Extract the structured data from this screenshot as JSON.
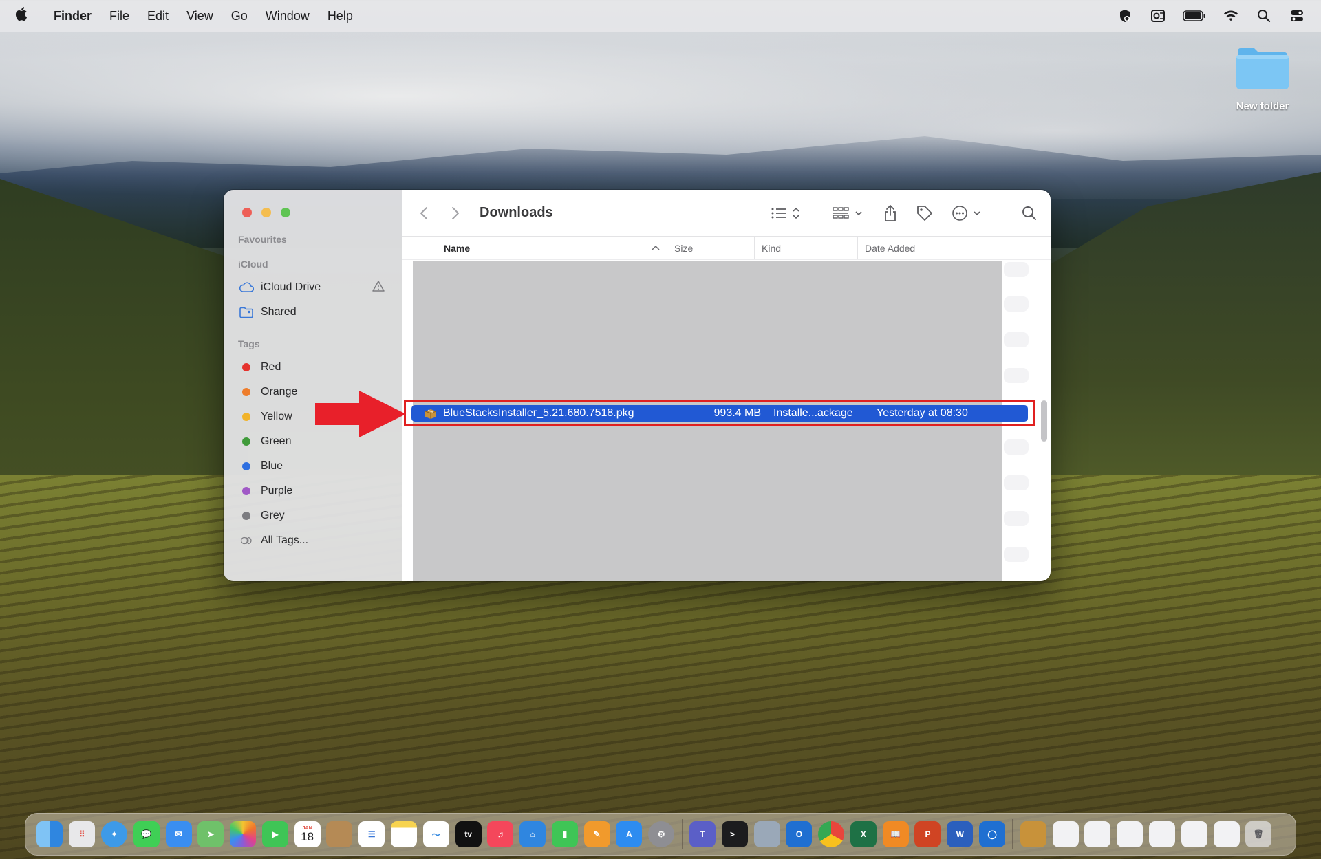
{
  "menubar": {
    "apple_icon": "apple-icon",
    "app_name": "Finder",
    "items": [
      "File",
      "Edit",
      "View",
      "Go",
      "Window",
      "Help"
    ],
    "status_icons": [
      "security-icon",
      "outlook-icon",
      "battery-icon",
      "wifi-icon",
      "spotlight-icon",
      "control-center-icon"
    ]
  },
  "desktop": {
    "folder_label": "New folder"
  },
  "finder": {
    "title": "Downloads",
    "sidebar": {
      "favourites_title": "Favourites",
      "icloud_title": "iCloud",
      "icloud_items": [
        {
          "label": "iCloud Drive",
          "icon": "cloud-icon"
        },
        {
          "label": "Shared",
          "icon": "shared-folder-icon"
        }
      ],
      "tags_title": "Tags",
      "tags": [
        {
          "label": "Red",
          "color": "#e5322d"
        },
        {
          "label": "Orange",
          "color": "#ee7d2b"
        },
        {
          "label": "Yellow",
          "color": "#f1b32a"
        },
        {
          "label": "Green",
          "color": "#3f9a3a"
        },
        {
          "label": "Blue",
          "color": "#2d6ee0"
        },
        {
          "label": "Purple",
          "color": "#a059c6"
        },
        {
          "label": "Grey",
          "color": "#7c7c80"
        }
      ],
      "all_tags_label": "All Tags..."
    },
    "columns": {
      "name": "Name",
      "size": "Size",
      "kind": "Kind",
      "date_added": "Date Added"
    },
    "selected_file": {
      "name": "BlueStacksInstaller_5.21.680.7518.pkg",
      "size": "993.4 MB",
      "kind": "Installe...ackage",
      "date_added": "Yesterday at 08:30"
    }
  },
  "dock": {
    "calendar_day": "18",
    "calendar_month": "JAN",
    "apps": [
      "finder",
      "launchpad",
      "safari",
      "messages",
      "mail",
      "maps",
      "photos",
      "facetime",
      "calendar",
      "contacts",
      "reminders",
      "notes",
      "freeform",
      "tv",
      "music",
      "keynote",
      "numbers",
      "pages",
      "app-store",
      "system-settings",
      "teams",
      "terminal",
      "preview",
      "outlook",
      "chrome",
      "excel",
      "books",
      "powerpoint",
      "word",
      "onedrive"
    ]
  },
  "colors": {
    "selection": "#2159d4",
    "annotation": "#e02020"
  }
}
